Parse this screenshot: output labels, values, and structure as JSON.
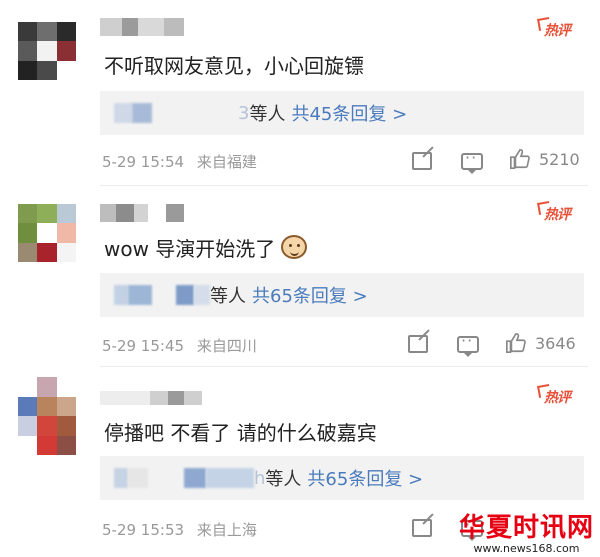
{
  "comments": [
    {
      "hot_label": "热评",
      "text": "不听取网友意见，小心回旋镖",
      "emoji": "",
      "reply_prefix_visible": "3",
      "reply_suffix": "等人",
      "reply_link": "共45条回复 >",
      "time": "5-29 15:54",
      "source": "来自福建",
      "likes": "5210"
    },
    {
      "hot_label": "热评",
      "text": "wow 导演开始洗了",
      "emoji": "cat-face-emoji",
      "reply_prefix_visible": "",
      "reply_suffix": "等人",
      "reply_link": "共65条回复 >",
      "time": "5-29 15:45",
      "source": "来自四川",
      "likes": "3646"
    },
    {
      "hot_label": "热评",
      "text": "停播吧 不看了 请的什么破嘉宾",
      "emoji": "",
      "reply_prefix_visible": "h",
      "reply_suffix": "等人",
      "reply_link": "共65条回复 >",
      "time": "5-29 15:53",
      "source": "来自上海",
      "likes": ""
    }
  ],
  "watermark": {
    "title": "华夏时讯网",
    "url": "www.news168.com"
  },
  "colors": {
    "hot": "#e8523a",
    "link": "#4a7bbd",
    "meta": "#999999",
    "reply_bg": "#f2f2f2"
  }
}
